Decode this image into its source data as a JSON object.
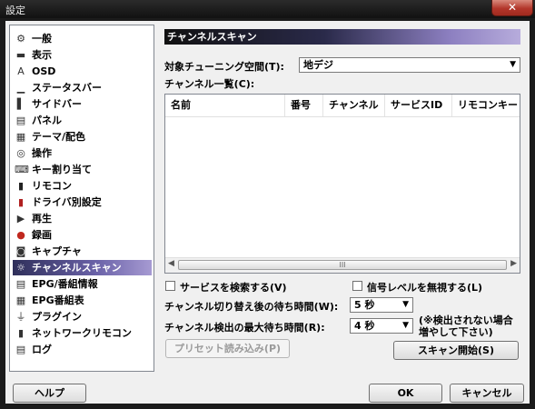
{
  "window": {
    "title": "設定",
    "close_glyph": "✕"
  },
  "sidebar": {
    "items": [
      {
        "label": "一般",
        "icon": "gear-icon"
      },
      {
        "label": "表示",
        "icon": "monitor-icon"
      },
      {
        "label": "OSD",
        "icon": "osd-icon"
      },
      {
        "label": "ステータスバー",
        "icon": "statusbar-icon"
      },
      {
        "label": "サイドバー",
        "icon": "sidebar-icon"
      },
      {
        "label": "パネル",
        "icon": "panel-icon"
      },
      {
        "label": "テーマ/配色",
        "icon": "theme-icon"
      },
      {
        "label": "操作",
        "icon": "mouse-icon"
      },
      {
        "label": "キー割り当て",
        "icon": "keyboard-icon"
      },
      {
        "label": "リモコン",
        "icon": "remote-icon"
      },
      {
        "label": "ドライバ別設定",
        "icon": "driver-icon"
      },
      {
        "label": "再生",
        "icon": "play-icon"
      },
      {
        "label": "録画",
        "icon": "record-icon"
      },
      {
        "label": "キャプチャ",
        "icon": "camera-icon"
      },
      {
        "label": "チャンネルスキャン",
        "icon": "scan-icon",
        "selected": true
      },
      {
        "label": "EPG/番組情報",
        "icon": "epg-icon"
      },
      {
        "label": "EPG番組表",
        "icon": "program-guide-icon"
      },
      {
        "label": "プラグイン",
        "icon": "plugin-icon"
      },
      {
        "label": "ネットワークリモコン",
        "icon": "network-remote-icon"
      },
      {
        "label": "ログ",
        "icon": "log-icon"
      }
    ]
  },
  "panel": {
    "title": "チャンネルスキャン",
    "tuning_space_label": "対象チューニング空間(T):",
    "tuning_space_value": "地デジ",
    "channel_list_label": "チャンネル一覧(C):",
    "columns": [
      "名前",
      "番号",
      "チャンネル",
      "サービスID",
      "リモコンキー"
    ],
    "scroll_thumb_glyph": "III",
    "search_services_label": "サービスを検索する(V)",
    "search_services_checked": false,
    "ignore_signal_label": "信号レベルを無視する(L)",
    "ignore_signal_checked": false,
    "switch_wait_label": "チャンネル切り替え後の待ち時間(W):",
    "switch_wait_value": "5 秒",
    "max_wait_label": "チャンネル検出の最大待ち時間(R):",
    "max_wait_value": "4 秒",
    "note_line1": "(※検出されない場合",
    "note_line2": "増やして下さい)",
    "preset_button": "プリセット読み込み(P)",
    "scan_button": "スキャン開始(S)"
  },
  "footer": {
    "help_button": "ヘルプ",
    "ok_button": "OK",
    "cancel_button": "キャンセル"
  }
}
